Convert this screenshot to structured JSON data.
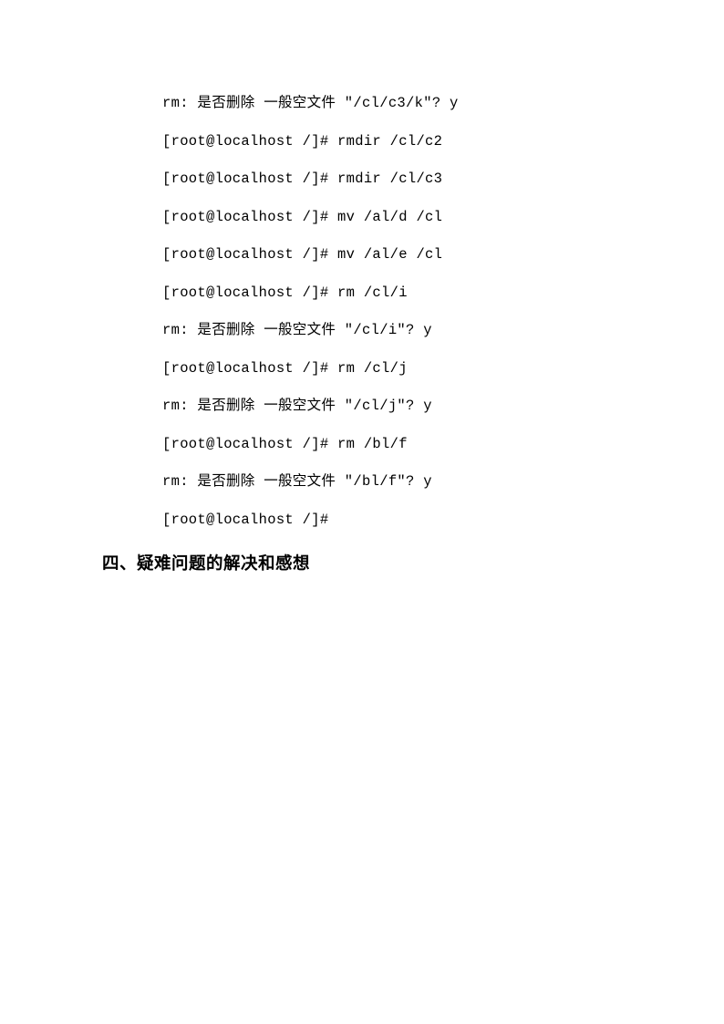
{
  "lines": [
    "rm: 是否删除 一般空文件 \"/cl/c3/k\"? y",
    "[root@localhost /]# rmdir /cl/c2",
    "[root@localhost /]# rmdir /cl/c3",
    "[root@localhost /]# mv /al/d /cl",
    "[root@localhost /]# mv /al/e /cl",
    "[root@localhost /]# rm /cl/i",
    "rm: 是否删除 一般空文件 \"/cl/i\"? y",
    "[root@localhost /]# rm /cl/j",
    "rm: 是否删除 一般空文件 \"/cl/j\"? y",
    "[root@localhost /]# rm /bl/f",
    "rm: 是否删除 一般空文件 \"/bl/f\"? y",
    "[root@localhost /]#"
  ],
  "heading": "四、疑难问题的解决和感想"
}
